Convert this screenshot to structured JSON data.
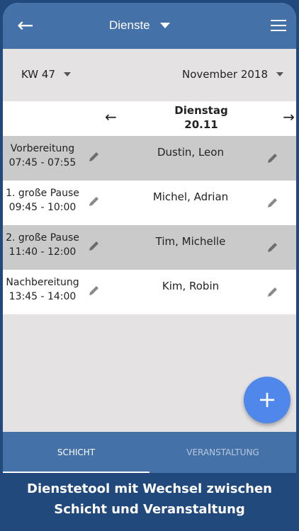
{
  "header": {
    "title": "Dienste",
    "icons": [
      "arrow-left-icon",
      "caret-down-icon",
      "hamburger-menu-icon"
    ]
  },
  "filters": {
    "week": "KW 47",
    "month": "November 2018"
  },
  "day": {
    "name": "Dienstag",
    "date": "20.11"
  },
  "rows": [
    {
      "slot": "Vorbereitung",
      "time": "07:45 - 07:55",
      "names": "Dustin, Leon"
    },
    {
      "slot": "1. große Pause",
      "time": "09:45 - 10:00",
      "names": "Michel, Adrian"
    },
    {
      "slot": "2. große Pause",
      "time": "11:40 - 12:00",
      "names": "Tim, Michelle"
    },
    {
      "slot": "Nachbereitung",
      "time": "13:45 - 14:00",
      "names": "Kim, Robin"
    }
  ],
  "fab": "+",
  "tabs": {
    "left": "SCHICHT",
    "right": "VERANSTALTUNG"
  },
  "caption": {
    "line1": "Dienstetool mit Wechsel zwischen",
    "line2": "Schicht und Veranstaltung"
  },
  "colors": {
    "appbar": "#4472a8",
    "fab": "#4f88ea",
    "background": "#21497c",
    "row_gray": "#cbcacb"
  }
}
